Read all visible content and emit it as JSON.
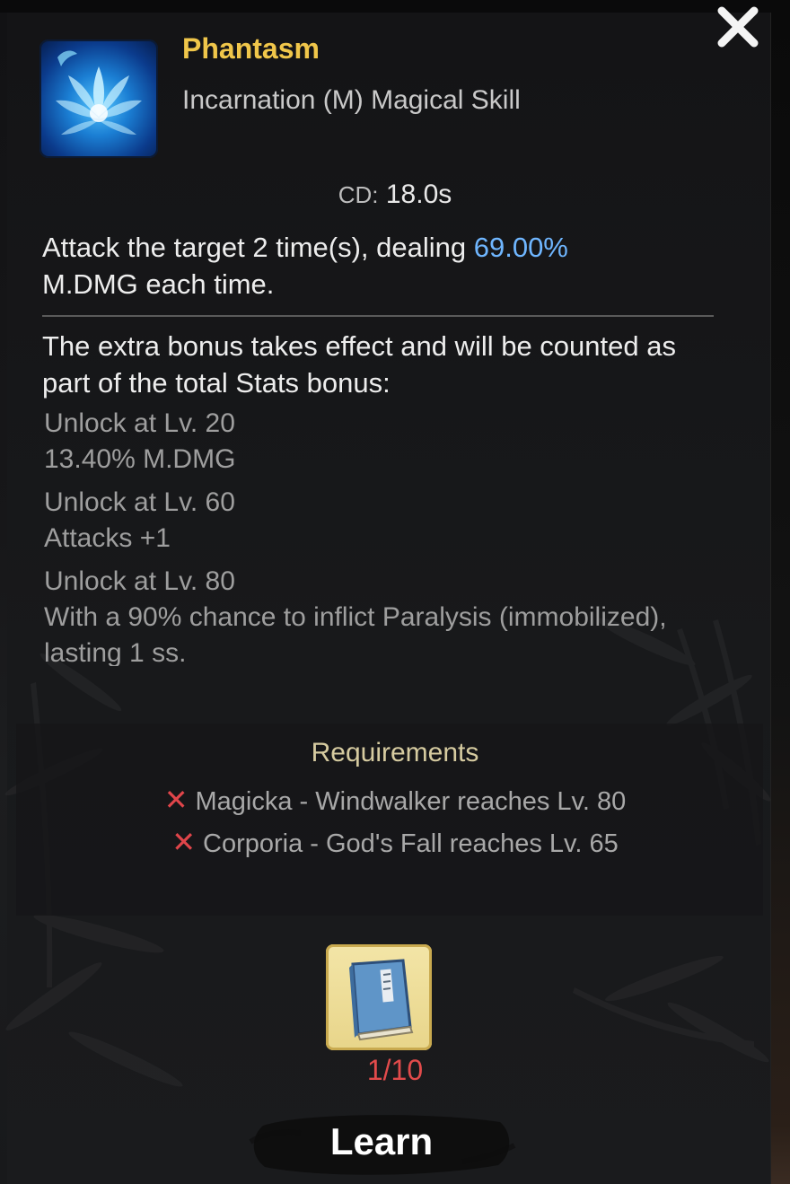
{
  "skill": {
    "name": "Phantasm",
    "type": "Incarnation (M) Magical Skill",
    "icon": "blue-lotus-icon"
  },
  "cooldown": {
    "label": "CD:",
    "value": "18.0s"
  },
  "description": {
    "prefix": "Attack the target 2 time(s), dealing ",
    "highlight": "69.00%",
    "suffix": "M.DMG each time.",
    "highlight_color": "#6fb6ff"
  },
  "bonus": {
    "intro": "The extra bonus takes effect and will be counted as part of the total Stats bonus:",
    "unlocks": [
      {
        "level": "Unlock at Lv. 20",
        "effect": "13.40% M.DMG"
      },
      {
        "level": "Unlock at Lv. 60",
        "effect": "Attacks +1"
      },
      {
        "level": "Unlock at Lv. 80",
        "effect": "With a 90% chance to inflict Paralysis (immobilized), lasting 1 ss."
      }
    ]
  },
  "requirements": {
    "title": "Requirements",
    "items": [
      {
        "text": "Magicka - Windwalker reaches Lv. 80",
        "met": false
      },
      {
        "text": "Corporia - God's Fall reaches Lv. 65",
        "met": false
      }
    ],
    "unmet_mark": "✕",
    "unmet_color": "#e0454a"
  },
  "cost": {
    "item_icon": "skill-book-icon",
    "count": "1/10",
    "count_color": "#e24b4b"
  },
  "actions": {
    "learn_label": "Learn",
    "close_icon": "close-icon"
  },
  "colors": {
    "title": "#f0c64a",
    "background": "#161618"
  }
}
